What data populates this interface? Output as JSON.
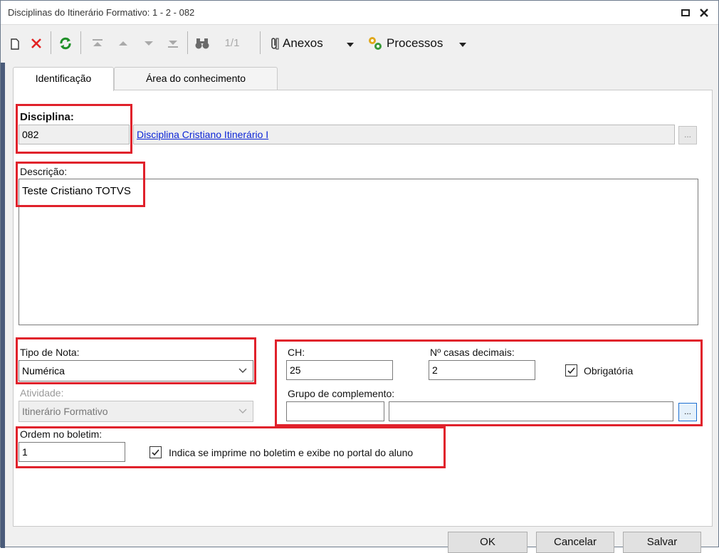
{
  "window": {
    "title": "Disciplinas do Itinerário Formativo: 1 - 2 - 082",
    "restore_glyph": "▫",
    "close_glyph": "x"
  },
  "toolbar": {
    "record_counter": "1/1",
    "attachments_label": "Anexos",
    "processes_label": "Processos"
  },
  "tabs": [
    {
      "label": "Identificação",
      "active": true
    },
    {
      "label": "Área do conhecimento",
      "active": false
    }
  ],
  "form": {
    "disciplina_label": "Disciplina:",
    "disciplina_code": "082",
    "disciplina_name": "Disciplina Cristiano Itinerário I",
    "lookup_button": "...",
    "descricao_label": "Descrição:",
    "descricao_value": "Teste Cristiano TOTVS",
    "tipo_nota_label": "Tipo de Nota:",
    "tipo_nota_value": "Numérica",
    "atividade_label": "Atividade:",
    "atividade_value": "Itinerário Formativo",
    "ch_label": "CH:",
    "ch_value": "25",
    "casas_label": "Nº casas decimais:",
    "casas_value": "2",
    "obrigatoria_label": "Obrigatória",
    "grupo_label": "Grupo de complemento:",
    "grupo_code": "",
    "grupo_name": "",
    "grupo_button": "...",
    "ordem_label": "Ordem no boletim:",
    "ordem_value": "1",
    "imprime_label": "Indica se imprime no boletim e exibe no portal do aluno"
  },
  "footer": {
    "ok": "OK",
    "cancel": "Cancelar",
    "save": "Salvar"
  },
  "colors": {
    "highlight": "#e0212b",
    "link": "#0b24d6"
  }
}
